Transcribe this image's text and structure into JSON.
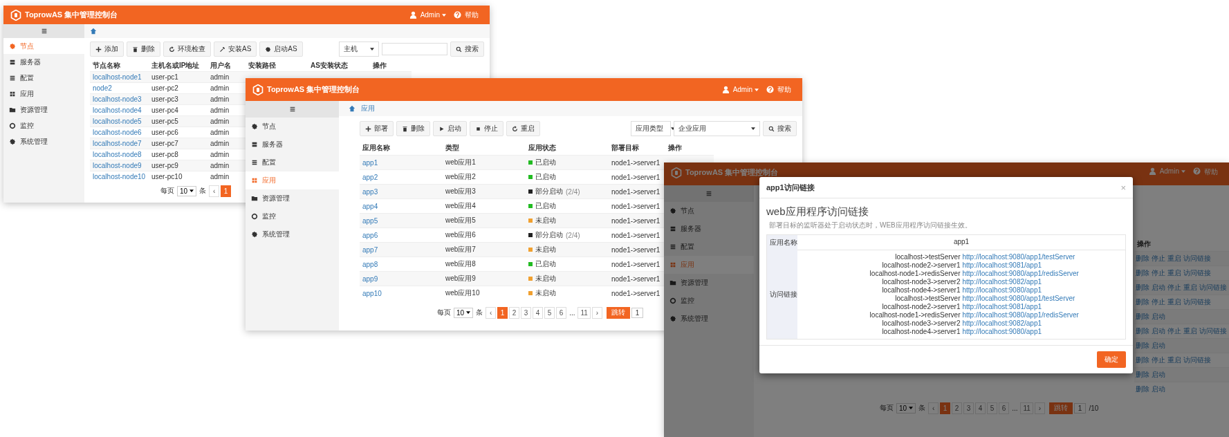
{
  "windows": [
    {
      "header": {
        "title": "ToprowAS 集中管理控制台",
        "user": "Admin",
        "help": "帮助"
      },
      "sidebar": [
        {
          "label": "节点",
          "selected": true
        },
        {
          "label": "服务器",
          "selected": false
        },
        {
          "label": "配置",
          "selected": false
        },
        {
          "label": "应用",
          "selected": false
        },
        {
          "label": "资源管理",
          "selected": false
        },
        {
          "label": "监控",
          "selected": false
        },
        {
          "label": "系统管理",
          "selected": false
        }
      ],
      "toolbar": [
        "添加",
        "删除",
        "环境检查",
        "安装AS",
        "启动AS"
      ],
      "filters": [
        {
          "kind": "select",
          "text": "主机"
        },
        {
          "kind": "input"
        }
      ],
      "search": "搜索",
      "table": {
        "columns": [
          {
            "label": "节点名称",
            "kind": "link"
          },
          {
            "label": "主机名或IP地址",
            "kind": "text"
          },
          {
            "label": "用户名",
            "kind": "text"
          },
          {
            "label": "安装路径"
          },
          {
            "label": "AS安装状态"
          },
          {
            "label": "操作"
          }
        ],
        "rows": [
          {
            "cells": [
              "localhost-node1",
              "user-pc1",
              "admin"
            ]
          },
          {
            "cells": [
              "node2",
              "user-pc2",
              "admin"
            ]
          },
          {
            "cells": [
              "localhost-node3",
              "user-pc3",
              "admin"
            ]
          },
          {
            "cells": [
              "localhost-node4",
              "user-pc4",
              "admin"
            ]
          },
          {
            "cells": [
              "localhost-node5",
              "user-pc5",
              "admin"
            ]
          },
          {
            "cells": [
              "localhost-node6",
              "user-pc6",
              "admin"
            ]
          },
          {
            "cells": [
              "localhost-node7",
              "user-pc7",
              "admin"
            ]
          },
          {
            "cells": [
              "localhost-node8",
              "user-pc8",
              "admin"
            ]
          },
          {
            "cells": [
              "localhost-node9",
              "user-pc9",
              "admin"
            ]
          },
          {
            "cells": [
              "localhost-node10",
              "user-pc10",
              "admin"
            ]
          }
        ]
      },
      "pagination": [
        {
          "kind": "text",
          "label": "每页"
        },
        {
          "kind": "select",
          "label": "10"
        },
        {
          "kind": "text",
          "label": "条"
        },
        {
          "kind": "nav",
          "label": "‹"
        },
        {
          "kind": "page",
          "label": "1",
          "selected": true
        }
      ]
    },
    {
      "header": {
        "title": "ToprowAS 集中管理控制台",
        "user": "Admin",
        "help": "帮助"
      },
      "sidebar": [
        {
          "label": "节点",
          "selected": false
        },
        {
          "label": "服务器",
          "selected": false
        },
        {
          "label": "配置",
          "selected": false
        },
        {
          "label": "应用",
          "selected": true
        },
        {
          "label": "资源管理",
          "selected": false
        },
        {
          "label": "监控",
          "selected": false
        },
        {
          "label": "系统管理",
          "selected": false
        }
      ],
      "breadcrumb": "应用",
      "toolbar": [
        "部署",
        "删除",
        "启动",
        "停止",
        "重启"
      ],
      "filters": [
        {
          "kind": "select",
          "text": "应用类型"
        },
        {
          "kind": "wideselect",
          "text": "企业应用"
        }
      ],
      "search": "搜索",
      "table": {
        "columns": [
          {
            "label": "应用名称",
            "kind": "link"
          },
          {
            "label": "类型",
            "kind": "text"
          },
          {
            "label": "应用状态",
            "kind": "status"
          },
          {
            "label": "部署目标",
            "kind": "text"
          },
          {
            "label": "操作"
          }
        ],
        "rows": [
          {
            "cells": [
              "app1",
              "web应用1",
              {
                "text": "已启动",
                "color": "#22bb22"
              },
              "node1->server1"
            ]
          },
          {
            "cells": [
              "app2",
              "web应用2",
              {
                "text": "已启动",
                "color": "#22bb22"
              },
              "node1->server1"
            ]
          },
          {
            "cells": [
              "app3",
              "web应用3",
              {
                "text": "部分启动",
                "note": "(2/4)",
                "color": "#222222"
              },
              "node1->server1"
            ]
          },
          {
            "cells": [
              "app4",
              "web应用4",
              {
                "text": "已启动",
                "color": "#22bb22"
              },
              "node1->server1"
            ]
          },
          {
            "cells": [
              "app5",
              "web应用5",
              {
                "text": "未启动",
                "color": "#f0a030"
              },
              "node1->server1"
            ]
          },
          {
            "cells": [
              "app6",
              "web应用6",
              {
                "text": "部分启动",
                "note": "(2/4)",
                "color": "#222222"
              },
              "node1->server1"
            ]
          },
          {
            "cells": [
              "app7",
              "web应用7",
              {
                "text": "未启动",
                "color": "#f0a030"
              },
              "node1->server1"
            ]
          },
          {
            "cells": [
              "app8",
              "web应用8",
              {
                "text": "已启动",
                "color": "#22bb22"
              },
              "node1->server1"
            ]
          },
          {
            "cells": [
              "app9",
              "web应用9",
              {
                "text": "未启动",
                "color": "#f0a030"
              },
              "node1->server1"
            ]
          },
          {
            "cells": [
              "app10",
              "web应用10",
              {
                "text": "未启动",
                "color": "#f0a030"
              },
              "node1->server1"
            ]
          }
        ]
      },
      "pagination": [
        {
          "kind": "text",
          "label": "每页"
        },
        {
          "kind": "select",
          "label": "10"
        },
        {
          "kind": "text",
          "label": "条"
        },
        {
          "kind": "nav",
          "label": "‹"
        },
        {
          "kind": "page",
          "label": "1",
          "selected": true
        },
        {
          "kind": "page",
          "label": "2",
          "selected": false
        },
        {
          "kind": "page",
          "label": "3",
          "selected": false
        },
        {
          "kind": "page",
          "label": "4",
          "selected": false
        },
        {
          "kind": "page",
          "label": "5",
          "selected": false
        },
        {
          "kind": "page",
          "label": "6",
          "selected": false
        },
        {
          "kind": "text",
          "label": "..."
        },
        {
          "kind": "page",
          "label": "11",
          "selected": false
        },
        {
          "kind": "nav",
          "label": "›"
        },
        {
          "kind": "jump",
          "label": "跳转"
        },
        {
          "kind": "input",
          "label": "1"
        }
      ]
    },
    {
      "header": {
        "title": "ToprowAS 集中管理控制台",
        "user": "Admin",
        "help": "帮助"
      },
      "sidebar": [
        {
          "label": "节点",
          "selected": false
        },
        {
          "label": "服务器",
          "selected": false
        },
        {
          "label": "配置",
          "selected": false
        },
        {
          "label": "应用",
          "selected": true
        },
        {
          "label": "资源管理",
          "selected": false
        },
        {
          "label": "监控",
          "selected": false
        },
        {
          "label": "系统管理",
          "selected": false
        }
      ],
      "table": {
        "columns": [
          {
            "label": "操作",
            "kind": "ops"
          }
        ],
        "rows": [
          {
            "cells": [
              [
                "删除",
                "停止",
                "重启",
                "访问链接"
              ]
            ]
          },
          {
            "cells": [
              [
                "删除",
                "停止",
                "重启",
                "访问链接"
              ]
            ]
          },
          {
            "cells": [
              [
                "删除",
                "启动",
                "停止",
                "重启",
                "访问链接"
              ]
            ]
          },
          {
            "cells": [
              [
                "删除",
                "停止",
                "重启",
                "访问链接"
              ]
            ]
          },
          {
            "cells": [
              [
                "删除",
                "启动"
              ]
            ]
          },
          {
            "cells": [
              [
                "删除",
                "启动",
                "停止",
                "重启",
                "访问链接"
              ]
            ]
          },
          {
            "cells": [
              [
                "删除",
                "启动"
              ]
            ]
          },
          {
            "cells": [
              [
                "删除",
                "停止",
                "重启",
                "访问链接"
              ]
            ]
          },
          {
            "cells": [
              [
                "删除",
                "启动"
              ]
            ]
          },
          {
            "cells": [
              [
                "删除",
                "启动"
              ]
            ]
          }
        ]
      },
      "pagination": [
        {
          "kind": "text",
          "label": "每页"
        },
        {
          "kind": "select",
          "label": "10"
        },
        {
          "kind": "text",
          "label": "条"
        },
        {
          "kind": "nav",
          "label": "‹"
        },
        {
          "kind": "page",
          "label": "1",
          "selected": true
        },
        {
          "kind": "page",
          "label": "2",
          "selected": false
        },
        {
          "kind": "page",
          "label": "3",
          "selected": false
        },
        {
          "kind": "page",
          "label": "4",
          "selected": false
        },
        {
          "kind": "page",
          "label": "5",
          "selected": false
        },
        {
          "kind": "page",
          "label": "6",
          "selected": false
        },
        {
          "kind": "text",
          "label": "..."
        },
        {
          "kind": "page",
          "label": "11",
          "selected": false
        },
        {
          "kind": "nav",
          "label": "›"
        },
        {
          "kind": "jump",
          "label": "跳转"
        },
        {
          "kind": "input",
          "label": "1"
        },
        {
          "kind": "text",
          "label": "/10"
        }
      ],
      "modal": {
        "title": "app1访问链接",
        "close": "×",
        "heading": "web应用程序访问链接",
        "note": "部署目标的监听器处于启动状态时，WEB应用程序访问链接生效。",
        "name_label": "应用名称",
        "name_value": "app1",
        "links_label": "访问链接",
        "links": [
          {
            "target": "localhost->testServer",
            "url": "http://localhost:9080/app1/testServer"
          },
          {
            "target": "localhost-node2->server1",
            "url": "http://localhost:9081/app1"
          },
          {
            "target": "localhost-node1->redisServer",
            "url": "http://localhost:9080/app1/redisServer"
          },
          {
            "target": "localhost-node3->server2",
            "url": "http://localhost:9082/app1"
          },
          {
            "target": "localhost-node4->server1",
            "url": "http://localhost:9080/app1"
          },
          {
            "target": "localhost->testServer",
            "url": "http://localhost:9080/app1/testServer"
          },
          {
            "target": "localhost-node2->server1",
            "url": "http://localhost:9081/app1"
          },
          {
            "target": "localhost-node1->redisServer",
            "url": "http://localhost:9080/app1/redisServer"
          },
          {
            "target": "localhost-node3->server2",
            "url": "http://localhost:9082/app1"
          },
          {
            "target": "localhost-node4->server1",
            "url": "http://localhost:9080/app1"
          }
        ],
        "ok": "确定"
      }
    }
  ]
}
